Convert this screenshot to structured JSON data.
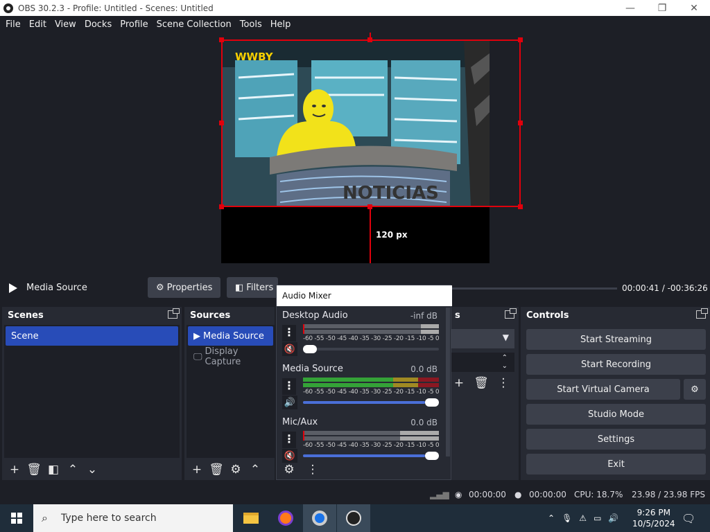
{
  "window": {
    "title": "OBS 30.2.3 - Profile: Untitled - Scenes: Untitled"
  },
  "menu": [
    "File",
    "Edit",
    "View",
    "Docks",
    "Profile",
    "Scene Collection",
    "Tools",
    "Help"
  ],
  "preview": {
    "logo_text": "WWBY",
    "desk_text": "NOTICIAS",
    "offset_label": "120 px"
  },
  "context": {
    "source_name": "Media Source",
    "properties_label": "Properties",
    "filters_label": "Filters",
    "time": "00:00:41  /  -00:36:26"
  },
  "scenes": {
    "title": "Scenes",
    "items": [
      "Scene"
    ]
  },
  "sources": {
    "title": "Sources",
    "items": [
      "Media Source",
      "Display Capture"
    ]
  },
  "transitions": {
    "title": "s"
  },
  "controls": {
    "title": "Controls",
    "start_streaming": "Start Streaming",
    "start_recording": "Start Recording",
    "start_virtual_camera": "Start Virtual Camera",
    "studio_mode": "Studio Mode",
    "settings": "Settings",
    "exit": "Exit"
  },
  "mixer": {
    "title": "Audio Mixer",
    "ticks": "-60 -55 -50 -45 -40 -35 -30 -25 -20 -15 -10 -5  0",
    "channels": [
      {
        "name": "Desktop Audio",
        "db": "-inf dB",
        "level": 0.0,
        "volume": 0.0,
        "muted": true
      },
      {
        "name": "Media Source",
        "db": "0.0 dB",
        "level": 0.85,
        "volume": 1.0,
        "muted": false
      },
      {
        "name": "Mic/Aux",
        "db": "0.0 dB",
        "level": 0.0,
        "volume": 1.0,
        "muted": true
      }
    ]
  },
  "status": {
    "stream_time": "00:00:00",
    "record_time": "00:00:00",
    "cpu": "CPU: 18.7%",
    "fps": "23.98 / 23.98 FPS"
  },
  "taskbar": {
    "search_placeholder": "Type here to search",
    "time": "9:26 PM",
    "date": "10/5/2024"
  },
  "colors": {
    "accent": "#284cb8",
    "selection": "#e1000c",
    "panel": "#272a33",
    "background": "#1d1f26"
  }
}
